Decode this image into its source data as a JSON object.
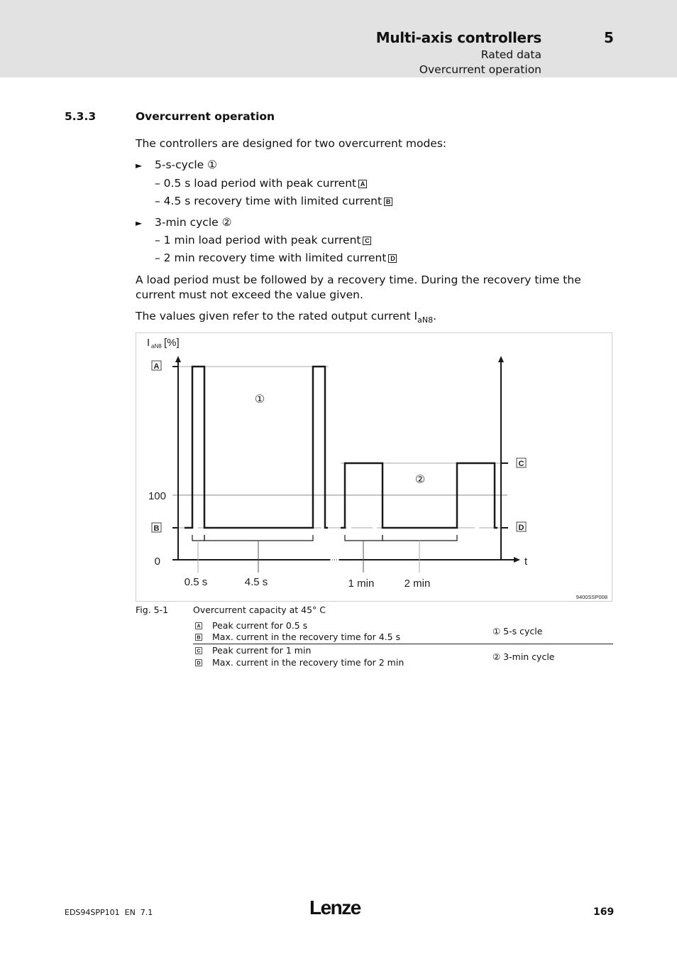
{
  "header": {
    "title": "Multi-axis controllers",
    "chapter": "5",
    "subtitle1": "Rated data",
    "subtitle2": "Overcurrent operation"
  },
  "section": {
    "number": "5.3.3",
    "title": "Overcurrent operation",
    "intro": "The controllers are designed for two overcurrent modes:",
    "bullets": [
      {
        "label": "5-s-cycle",
        "marker": "①",
        "items": [
          {
            "text": "– 0.5 s load period with peak current",
            "box": "A"
          },
          {
            "text": "– 4.5 s recovery time with limited current",
            "box": "B"
          }
        ]
      },
      {
        "label": "3-min cycle",
        "marker": "②",
        "items": [
          {
            "text": "– 1 min load period with peak current",
            "box": "C"
          },
          {
            "text": "– 2 min recovery time with limited current",
            "box": "D"
          }
        ]
      }
    ],
    "para1": "A load period must be followed by a recovery time. During the recovery time the current must not exceed the value given.",
    "para2_pre": "The values given refer to the rated output current I",
    "para2_sub": "aN8",
    "para2_post": "."
  },
  "chart_data": {
    "type": "line",
    "title": "Overcurrent capacity at 45° C",
    "ylabel": "I",
    "ylabel_sub": "aN8",
    "ylabel_unit": "[%]",
    "xlabel": "t",
    "y_ticks": [
      "0",
      "100"
    ],
    "level_labels": {
      "A": "A",
      "B": "B",
      "C": "C",
      "D": "D"
    },
    "cycle_markers": {
      "cycle1": "①",
      "cycle2": "②"
    },
    "durations": [
      "0.5 s",
      "4.5 s",
      "1 min",
      "2 min"
    ],
    "series": [
      {
        "name": "5-s cycle",
        "segments": [
          {
            "level": "B",
            "duration": "lead"
          },
          {
            "level": "A",
            "duration": "0.5 s"
          },
          {
            "level": "B",
            "duration": "4.5 s"
          },
          {
            "level": "A",
            "duration": "0.5 s"
          },
          {
            "level": "B",
            "duration": "tail"
          }
        ]
      },
      {
        "name": "3-min cycle",
        "segments": [
          {
            "level": "D",
            "duration": "lead"
          },
          {
            "level": "C",
            "duration": "1 min"
          },
          {
            "level": "D",
            "duration": "2 min"
          },
          {
            "level": "C",
            "duration": "1 min"
          },
          {
            "level": "D",
            "duration": "tail"
          }
        ]
      }
    ],
    "image_code": "9400SSP008"
  },
  "figure": {
    "number": "Fig. 5-1",
    "caption": "Overcurrent capacity at 45° C",
    "legend": [
      {
        "box": "A",
        "text": "Peak current for 0.5 s"
      },
      {
        "box": "B",
        "text": "Max. current in the recovery time for 4.5 s"
      },
      {
        "box": "C",
        "text": "Peak current for 1 min"
      },
      {
        "box": "D",
        "text": "Max. current in the recovery time for 2 min"
      }
    ],
    "cycles": [
      "① 5-s cycle",
      "② 3-min cycle"
    ]
  },
  "footer": {
    "doc_id": "EDS94SPP101  EN  7.1",
    "logo": "Lenze",
    "page": "169"
  }
}
